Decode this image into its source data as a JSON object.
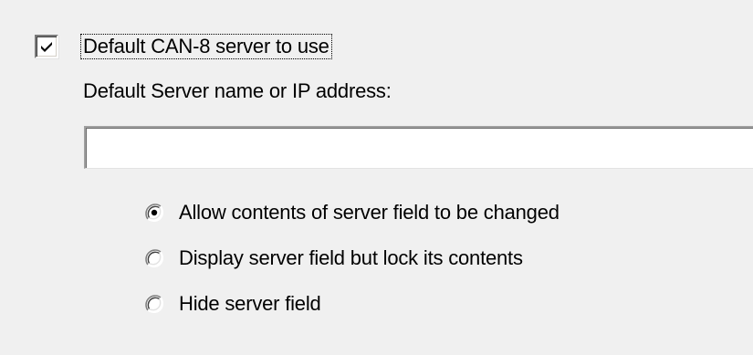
{
  "checkbox": {
    "label": "Default CAN-8 server to use",
    "checked": true
  },
  "server": {
    "label": "Default Server name or IP address:",
    "value": ""
  },
  "radio_options": [
    {
      "label": "Allow contents of server field to be changed",
      "selected": true
    },
    {
      "label": "Display server field but lock its contents",
      "selected": false
    },
    {
      "label": "Hide server field",
      "selected": false
    }
  ]
}
